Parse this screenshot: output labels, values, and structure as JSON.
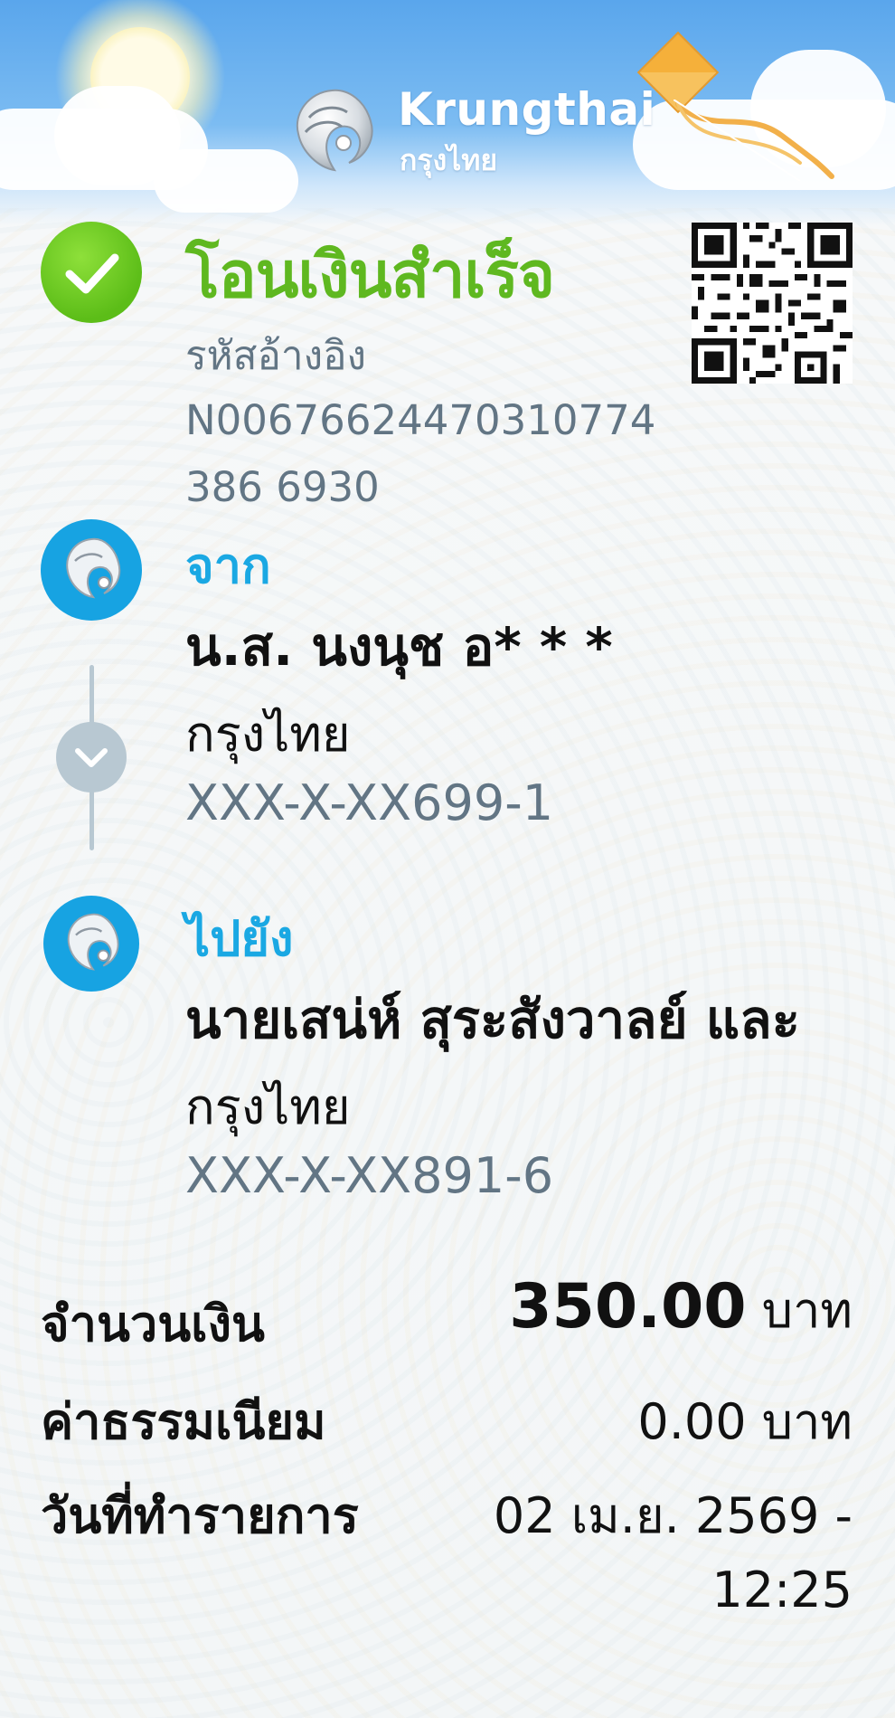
{
  "header": {
    "brand_en": "Krungthai",
    "brand_th": "กรุงไทย",
    "logo_icon": "krungthai-phoenix-logo"
  },
  "status": {
    "title": "โอนเงินสำเร็จ",
    "icon": "check-icon",
    "color": "#5fb820"
  },
  "reference": {
    "label": "รหัสอ้างอิง",
    "value": "N00676624470310774386 6930"
  },
  "from": {
    "label": "จาก",
    "name": "น.ส. นงนุช อ* * *",
    "bank": "กรุงไทย",
    "account": "XXX-X-XX699-1"
  },
  "to": {
    "label": "ไปยัง",
    "name": "นายเสน่ห์ สุระสังวาลย์ และ",
    "bank": "กรุงไทย",
    "account": "XXX-X-XX891-6"
  },
  "summary": {
    "amount_label": "จำนวนเงิน",
    "amount_value": "350.00",
    "amount_unit": "บาท",
    "fee_label": "ค่าธรรมเนียม",
    "fee_value": "0.00 บาท",
    "date_label": "วันที่ทำรายการ",
    "date_value_line1": "02 เม.ย. 2569 -",
    "date_value_line2": "12:25"
  },
  "colors": {
    "accent_blue": "#1aa8e3",
    "muted_text": "#627584",
    "header_blue": "#5aa6ec"
  }
}
